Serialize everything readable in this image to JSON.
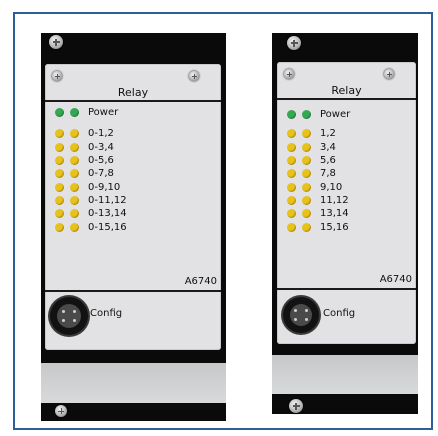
{
  "modules": [
    {
      "title": "Relay",
      "power_label": "Power",
      "channels": [
        "0-1,2",
        "0-3,4",
        "0-5,6",
        "0-7,8",
        "0-9,10",
        "0-11,12",
        "0-13,14",
        "0-15,16"
      ],
      "model": "A6740",
      "config_label": "Config"
    },
    {
      "title": "Relay",
      "power_label": "Power",
      "channels": [
        "1,2",
        "3,4",
        "5,6",
        "7,8",
        "9,10",
        "11,12",
        "13,14",
        "15,16"
      ],
      "model": "A6740",
      "config_label": "Config"
    }
  ],
  "colors": {
    "power_led": "#34a853",
    "channel_led": "#e8c11a",
    "frame": "#2f5f9a"
  }
}
